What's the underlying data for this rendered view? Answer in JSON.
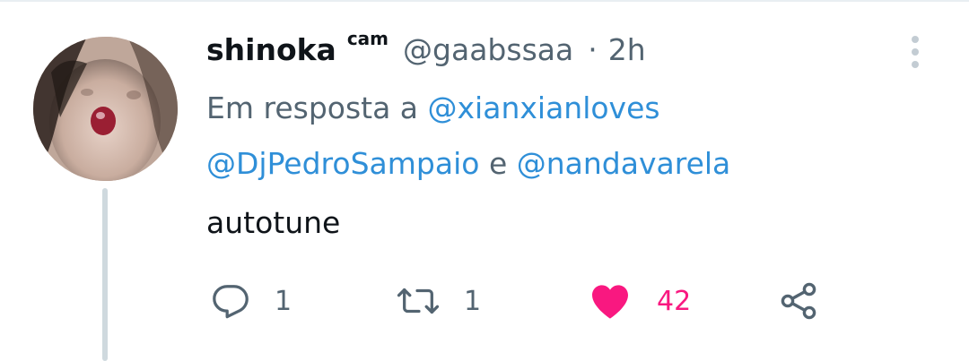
{
  "tweet": {
    "display_name": "shinoka",
    "name_suffix": "cam",
    "handle": "@gaabssaa",
    "separator": "·",
    "time": "2h",
    "reply_prefix": "Em resposta a",
    "mentions": [
      "@xianxianloves",
      "@DjPedroSampaio",
      "@nandavarela"
    ],
    "reply_conjunction": "e",
    "text": "autotune"
  },
  "actions": {
    "reply": {
      "icon": "reply-icon",
      "count": "1"
    },
    "retweet": {
      "icon": "retweet-icon",
      "count": "1"
    },
    "like": {
      "icon": "heart-icon",
      "count": "42",
      "active": true,
      "color": "#f91880"
    },
    "share": {
      "icon": "share-icon"
    }
  },
  "colors": {
    "text_primary": "#0f1419",
    "text_secondary": "#536471",
    "link": "#2f8fd8",
    "like": "#f91880",
    "thread_line": "#cfd9de"
  }
}
